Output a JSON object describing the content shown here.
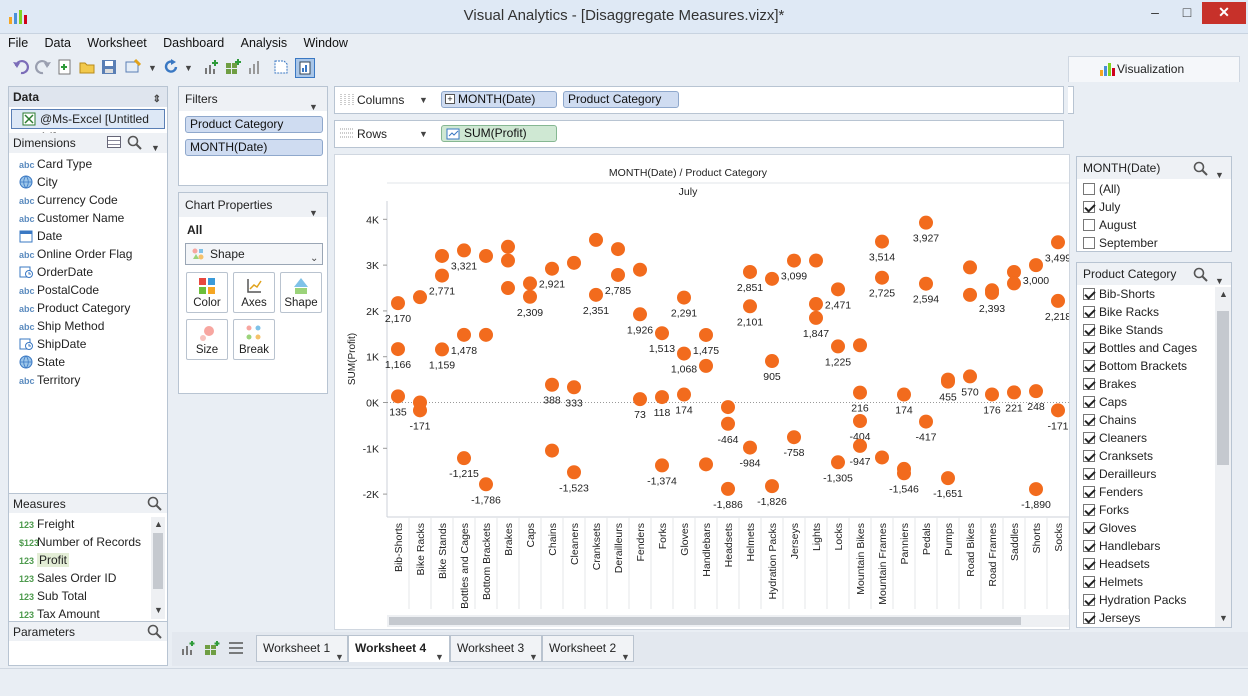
{
  "window": {
    "title": "Visual Analytics - [Disaggregate Measures.vizx]*",
    "minimize": "–",
    "maximize": "□",
    "close": "✕"
  },
  "menu": [
    "File",
    "Data",
    "Worksheet",
    "Dashboard",
    "Analysis",
    "Window"
  ],
  "visualization_tab": "Visualization",
  "data_panel": {
    "title": "Data",
    "source": "@Ms-Excel [Untitled 14]",
    "dimensions_title": "Dimensions",
    "dimensions": [
      {
        "type": "abc",
        "name": "Card Type"
      },
      {
        "type": "geo",
        "name": "City"
      },
      {
        "type": "abc",
        "name": "Currency Code"
      },
      {
        "type": "abc",
        "name": "Customer Name"
      },
      {
        "type": "date",
        "name": "Date"
      },
      {
        "type": "abc",
        "name": "Online Order Flag"
      },
      {
        "type": "datetime",
        "name": "OrderDate"
      },
      {
        "type": "abc",
        "name": "PostalCode"
      },
      {
        "type": "abc",
        "name": "Product Category"
      },
      {
        "type": "abc",
        "name": "Ship Method"
      },
      {
        "type": "datetime",
        "name": "ShipDate"
      },
      {
        "type": "geo",
        "name": "State"
      },
      {
        "type": "abc",
        "name": "Territory"
      }
    ],
    "measures_title": "Measures",
    "measures": [
      {
        "type": "123",
        "name": "Freight"
      },
      {
        "type": "$123",
        "name": "Number of Records"
      },
      {
        "type": "123",
        "name": "Profit"
      },
      {
        "type": "123",
        "name": "Sales Order ID"
      },
      {
        "type": "123",
        "name": "Sub Total"
      },
      {
        "type": "123",
        "name": "Tax Amount"
      }
    ],
    "parameters_title": "Parameters"
  },
  "filters": {
    "title": "Filters",
    "items": [
      "Product Category",
      "MONTH(Date)"
    ]
  },
  "chart_properties": {
    "title": "Chart Properties",
    "scope": "All",
    "mark_type": "Shape",
    "buttons": [
      "Color",
      "Axes",
      "Shape",
      "Size",
      "Break"
    ]
  },
  "shelves": {
    "columns_label": "Columns",
    "columns_pills": [
      "MONTH(Date)",
      "Product Category"
    ],
    "rows_label": "Rows",
    "rows_pills": [
      "SUM(Profit)"
    ]
  },
  "month_filter": {
    "title": "MONTH(Date)",
    "options": [
      {
        "label": "(All)",
        "checked": false
      },
      {
        "label": "July",
        "checked": true
      },
      {
        "label": "August",
        "checked": false
      },
      {
        "label": "September",
        "checked": false
      }
    ]
  },
  "category_filter": {
    "title": "Product Category",
    "options": [
      "Bib-Shorts",
      "Bike Racks",
      "Bike Stands",
      "Bottles and Cages",
      "Bottom Brackets",
      "Brakes",
      "Caps",
      "Chains",
      "Cleaners",
      "Cranksets",
      "Derailleurs",
      "Fenders",
      "Forks",
      "Gloves",
      "Handlebars",
      "Headsets",
      "Helmets",
      "Hydration Packs",
      "Jerseys"
    ]
  },
  "worksheet_tabs": [
    {
      "label": "Worksheet 1",
      "active": false
    },
    {
      "label": "Worksheet 4",
      "active": true
    },
    {
      "label": "Worksheet 3",
      "active": false
    },
    {
      "label": "Worksheet 2",
      "active": false
    }
  ],
  "colors": {
    "mark": "#f26b1d",
    "pill_blue": "#cfdcf1",
    "pill_green": "#cfe8d3",
    "close": "#c7312a"
  },
  "chart_data": {
    "type": "scatter",
    "title": "MONTH(Date) / Product Category",
    "column_header": "July",
    "ylabel": "SUM(Profit)",
    "ylim": [
      -2500,
      4400
    ],
    "yticks": [
      {
        "value": 4000,
        "label": "4K"
      },
      {
        "value": 3000,
        "label": "3K"
      },
      {
        "value": 2000,
        "label": "2K"
      },
      {
        "value": 1000,
        "label": "1K"
      },
      {
        "value": 0,
        "label": "0K"
      },
      {
        "value": -1000,
        "label": "-1K"
      },
      {
        "value": -2000,
        "label": "-2K"
      }
    ],
    "categories": [
      "Bib-Shorts",
      "Bike Racks",
      "Bike Stands",
      "Bottles and Cages",
      "Bottom Brackets",
      "Brakes",
      "Caps",
      "Chains",
      "Cleaners",
      "Cranksets",
      "Derailleurs",
      "Fenders",
      "Forks",
      "Gloves",
      "Handlebars",
      "Headsets",
      "Helmets",
      "Hydration Packs",
      "Jerseys",
      "Lights",
      "Locks",
      "Mountain Bikes",
      "Mountain Frames",
      "Panniers",
      "Pedals",
      "Pumps",
      "Road Bikes",
      "Road Frames",
      "Saddles",
      "Shorts",
      "Socks"
    ],
    "points": [
      {
        "cat": 0,
        "v": 2170,
        "label": "2,170"
      },
      {
        "cat": 0,
        "v": 1166,
        "label": "1,166"
      },
      {
        "cat": 0,
        "v": 135,
        "label": "135"
      },
      {
        "cat": 1,
        "v": 2300
      },
      {
        "cat": 1,
        "v": 0
      },
      {
        "cat": 1,
        "v": -171,
        "label": "-171"
      },
      {
        "cat": 2,
        "v": 3200
      },
      {
        "cat": 2,
        "v": 2771,
        "label": "2,771"
      },
      {
        "cat": 2,
        "v": 1159,
        "label": "1,159"
      },
      {
        "cat": 3,
        "v": 3321,
        "label": "3,321"
      },
      {
        "cat": 3,
        "v": 1478,
        "label": "1,478"
      },
      {
        "cat": 3,
        "v": -1215,
        "label": "-1,215"
      },
      {
        "cat": 4,
        "v": 3200
      },
      {
        "cat": 4,
        "v": 1478
      },
      {
        "cat": 4,
        "v": -1786,
        "label": "-1,786"
      },
      {
        "cat": 5,
        "v": 3400
      },
      {
        "cat": 5,
        "v": 3100
      },
      {
        "cat": 5,
        "v": 2500
      },
      {
        "cat": 6,
        "v": 2600
      },
      {
        "cat": 6,
        "v": 2309,
        "label": "2,309"
      },
      {
        "cat": 7,
        "v": 2921,
        "label": "2,921"
      },
      {
        "cat": 7,
        "v": 388,
        "label": "388"
      },
      {
        "cat": 7,
        "v": -1050
      },
      {
        "cat": 8,
        "v": 3050
      },
      {
        "cat": 8,
        "v": 333,
        "label": "333"
      },
      {
        "cat": 8,
        "v": -1523,
        "label": "-1,523"
      },
      {
        "cat": 9,
        "v": 3550
      },
      {
        "cat": 9,
        "v": 2351,
        "label": "2,351"
      },
      {
        "cat": 10,
        "v": 3350
      },
      {
        "cat": 10,
        "v": 2785,
        "label": "2,785"
      },
      {
        "cat": 11,
        "v": 2900
      },
      {
        "cat": 11,
        "v": 1926,
        "label": "1,926"
      },
      {
        "cat": 11,
        "v": 73,
        "label": "73"
      },
      {
        "cat": 12,
        "v": 1513,
        "label": "1,513"
      },
      {
        "cat": 12,
        "v": 118,
        "label": "118"
      },
      {
        "cat": 12,
        "v": -1374,
        "label": "-1,374"
      },
      {
        "cat": 13,
        "v": 2291,
        "label": "2,291"
      },
      {
        "cat": 13,
        "v": 1068,
        "label": "1,068"
      },
      {
        "cat": 13,
        "v": 174,
        "label": "174"
      },
      {
        "cat": 14,
        "v": 1475,
        "label": "1,475"
      },
      {
        "cat": 14,
        "v": 800
      },
      {
        "cat": 14,
        "v": -1350
      },
      {
        "cat": 15,
        "v": -100
      },
      {
        "cat": 15,
        "v": -464,
        "label": "-464"
      },
      {
        "cat": 15,
        "v": -1886,
        "label": "-1,886"
      },
      {
        "cat": 16,
        "v": 2851,
        "label": "2,851"
      },
      {
        "cat": 16,
        "v": 2101,
        "label": "2,101"
      },
      {
        "cat": 16,
        "v": -984,
        "label": "-984"
      },
      {
        "cat": 17,
        "v": 2700
      },
      {
        "cat": 17,
        "v": 905,
        "label": "905"
      },
      {
        "cat": 17,
        "v": -1826,
        "label": "-1,826"
      },
      {
        "cat": 18,
        "v": 3099,
        "label": "3,099"
      },
      {
        "cat": 18,
        "v": -758,
        "label": "-758"
      },
      {
        "cat": 19,
        "v": 3100
      },
      {
        "cat": 19,
        "v": 2150
      },
      {
        "cat": 19,
        "v": 1847,
        "label": "1,847"
      },
      {
        "cat": 20,
        "v": 2471,
        "label": "2,471"
      },
      {
        "cat": 20,
        "v": 1225,
        "label": "1,225"
      },
      {
        "cat": 20,
        "v": -1305,
        "label": "-1,305"
      },
      {
        "cat": 21,
        "v": 1250
      },
      {
        "cat": 21,
        "v": 216,
        "label": "216"
      },
      {
        "cat": 21,
        "v": -404,
        "label": "-404"
      },
      {
        "cat": 21,
        "v": -947,
        "label": "-947"
      },
      {
        "cat": 22,
        "v": 3514,
        "label": "3,514"
      },
      {
        "cat": 22,
        "v": 2725,
        "label": "2,725"
      },
      {
        "cat": 22,
        "v": -1200
      },
      {
        "cat": 23,
        "v": 174,
        "label": "174"
      },
      {
        "cat": 23,
        "v": -1450
      },
      {
        "cat": 23,
        "v": -1546,
        "label": "-1,546"
      },
      {
        "cat": 24,
        "v": 3927,
        "label": "3,927"
      },
      {
        "cat": 24,
        "v": 2594,
        "label": "2,594"
      },
      {
        "cat": 24,
        "v": -417,
        "label": "-417"
      },
      {
        "cat": 25,
        "v": 500
      },
      {
        "cat": 25,
        "v": 455,
        "label": "455"
      },
      {
        "cat": 25,
        "v": -1651,
        "label": "-1,651"
      },
      {
        "cat": 26,
        "v": 2950
      },
      {
        "cat": 26,
        "v": 2350
      },
      {
        "cat": 26,
        "v": 570,
        "label": "570"
      },
      {
        "cat": 27,
        "v": 2450
      },
      {
        "cat": 27,
        "v": 2393,
        "label": "2,393"
      },
      {
        "cat": 27,
        "v": 176,
        "label": "176"
      },
      {
        "cat": 28,
        "v": 2850
      },
      {
        "cat": 28,
        "v": 2600
      },
      {
        "cat": 28,
        "v": 221,
        "label": "221"
      },
      {
        "cat": 29,
        "v": 3000,
        "label": "3,000"
      },
      {
        "cat": 29,
        "v": 248,
        "label": "248"
      },
      {
        "cat": 29,
        "v": -1890,
        "label": "-1,890"
      },
      {
        "cat": 30,
        "v": 3499,
        "label": "3,499"
      },
      {
        "cat": 30,
        "v": 2218,
        "label": "2,218"
      },
      {
        "cat": 30,
        "v": -171,
        "label": "-171"
      }
    ]
  }
}
